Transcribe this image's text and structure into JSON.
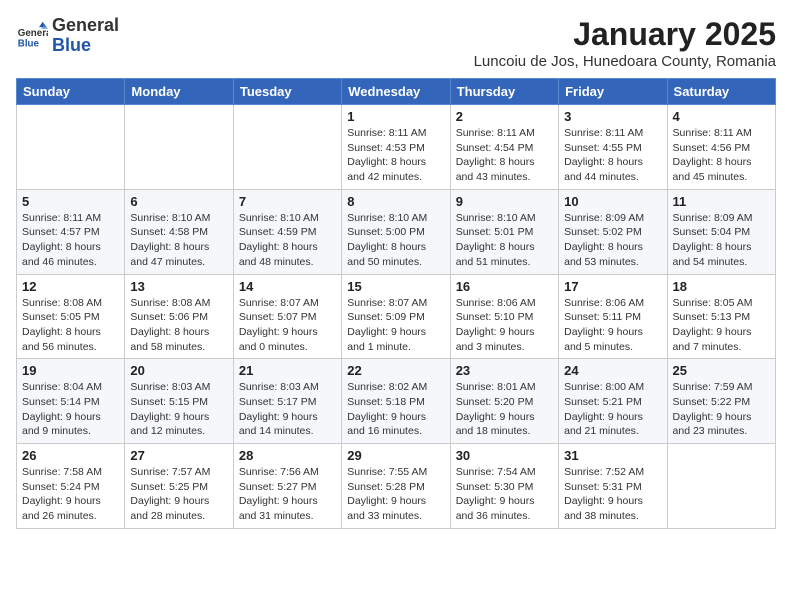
{
  "logo": {
    "general": "General",
    "blue": "Blue"
  },
  "header": {
    "month": "January 2025",
    "location": "Luncoiu de Jos, Hunedoara County, Romania"
  },
  "weekdays": [
    "Sunday",
    "Monday",
    "Tuesday",
    "Wednesday",
    "Thursday",
    "Friday",
    "Saturday"
  ],
  "weeks": [
    [
      {
        "day": "",
        "info": ""
      },
      {
        "day": "",
        "info": ""
      },
      {
        "day": "",
        "info": ""
      },
      {
        "day": "1",
        "info": "Sunrise: 8:11 AM\nSunset: 4:53 PM\nDaylight: 8 hours\nand 42 minutes."
      },
      {
        "day": "2",
        "info": "Sunrise: 8:11 AM\nSunset: 4:54 PM\nDaylight: 8 hours\nand 43 minutes."
      },
      {
        "day": "3",
        "info": "Sunrise: 8:11 AM\nSunset: 4:55 PM\nDaylight: 8 hours\nand 44 minutes."
      },
      {
        "day": "4",
        "info": "Sunrise: 8:11 AM\nSunset: 4:56 PM\nDaylight: 8 hours\nand 45 minutes."
      }
    ],
    [
      {
        "day": "5",
        "info": "Sunrise: 8:11 AM\nSunset: 4:57 PM\nDaylight: 8 hours\nand 46 minutes."
      },
      {
        "day": "6",
        "info": "Sunrise: 8:10 AM\nSunset: 4:58 PM\nDaylight: 8 hours\nand 47 minutes."
      },
      {
        "day": "7",
        "info": "Sunrise: 8:10 AM\nSunset: 4:59 PM\nDaylight: 8 hours\nand 48 minutes."
      },
      {
        "day": "8",
        "info": "Sunrise: 8:10 AM\nSunset: 5:00 PM\nDaylight: 8 hours\nand 50 minutes."
      },
      {
        "day": "9",
        "info": "Sunrise: 8:10 AM\nSunset: 5:01 PM\nDaylight: 8 hours\nand 51 minutes."
      },
      {
        "day": "10",
        "info": "Sunrise: 8:09 AM\nSunset: 5:02 PM\nDaylight: 8 hours\nand 53 minutes."
      },
      {
        "day": "11",
        "info": "Sunrise: 8:09 AM\nSunset: 5:04 PM\nDaylight: 8 hours\nand 54 minutes."
      }
    ],
    [
      {
        "day": "12",
        "info": "Sunrise: 8:08 AM\nSunset: 5:05 PM\nDaylight: 8 hours\nand 56 minutes."
      },
      {
        "day": "13",
        "info": "Sunrise: 8:08 AM\nSunset: 5:06 PM\nDaylight: 8 hours\nand 58 minutes."
      },
      {
        "day": "14",
        "info": "Sunrise: 8:07 AM\nSunset: 5:07 PM\nDaylight: 9 hours\nand 0 minutes."
      },
      {
        "day": "15",
        "info": "Sunrise: 8:07 AM\nSunset: 5:09 PM\nDaylight: 9 hours\nand 1 minute."
      },
      {
        "day": "16",
        "info": "Sunrise: 8:06 AM\nSunset: 5:10 PM\nDaylight: 9 hours\nand 3 minutes."
      },
      {
        "day": "17",
        "info": "Sunrise: 8:06 AM\nSunset: 5:11 PM\nDaylight: 9 hours\nand 5 minutes."
      },
      {
        "day": "18",
        "info": "Sunrise: 8:05 AM\nSunset: 5:13 PM\nDaylight: 9 hours\nand 7 minutes."
      }
    ],
    [
      {
        "day": "19",
        "info": "Sunrise: 8:04 AM\nSunset: 5:14 PM\nDaylight: 9 hours\nand 9 minutes."
      },
      {
        "day": "20",
        "info": "Sunrise: 8:03 AM\nSunset: 5:15 PM\nDaylight: 9 hours\nand 12 minutes."
      },
      {
        "day": "21",
        "info": "Sunrise: 8:03 AM\nSunset: 5:17 PM\nDaylight: 9 hours\nand 14 minutes."
      },
      {
        "day": "22",
        "info": "Sunrise: 8:02 AM\nSunset: 5:18 PM\nDaylight: 9 hours\nand 16 minutes."
      },
      {
        "day": "23",
        "info": "Sunrise: 8:01 AM\nSunset: 5:20 PM\nDaylight: 9 hours\nand 18 minutes."
      },
      {
        "day": "24",
        "info": "Sunrise: 8:00 AM\nSunset: 5:21 PM\nDaylight: 9 hours\nand 21 minutes."
      },
      {
        "day": "25",
        "info": "Sunrise: 7:59 AM\nSunset: 5:22 PM\nDaylight: 9 hours\nand 23 minutes."
      }
    ],
    [
      {
        "day": "26",
        "info": "Sunrise: 7:58 AM\nSunset: 5:24 PM\nDaylight: 9 hours\nand 26 minutes."
      },
      {
        "day": "27",
        "info": "Sunrise: 7:57 AM\nSunset: 5:25 PM\nDaylight: 9 hours\nand 28 minutes."
      },
      {
        "day": "28",
        "info": "Sunrise: 7:56 AM\nSunset: 5:27 PM\nDaylight: 9 hours\nand 31 minutes."
      },
      {
        "day": "29",
        "info": "Sunrise: 7:55 AM\nSunset: 5:28 PM\nDaylight: 9 hours\nand 33 minutes."
      },
      {
        "day": "30",
        "info": "Sunrise: 7:54 AM\nSunset: 5:30 PM\nDaylight: 9 hours\nand 36 minutes."
      },
      {
        "day": "31",
        "info": "Sunrise: 7:52 AM\nSunset: 5:31 PM\nDaylight: 9 hours\nand 38 minutes."
      },
      {
        "day": "",
        "info": ""
      }
    ]
  ]
}
